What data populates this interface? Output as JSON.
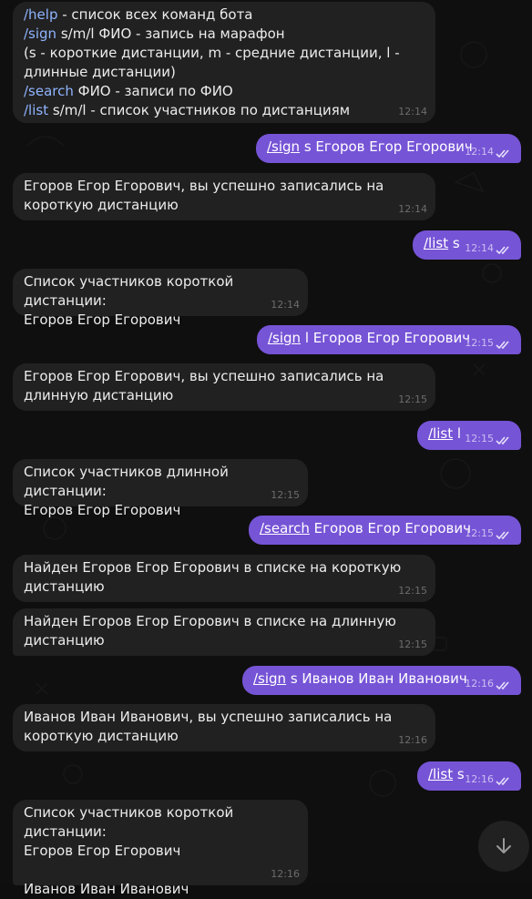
{
  "messages": [
    {
      "id": "m1",
      "side": "in",
      "parts": [
        {
          "cmd": "/help",
          "text": " - список всех команд бота\n"
        },
        {
          "cmd": "/sign",
          "text": " s/m/l ФИО - запись на марафон\n(s - короткие дистанции, m - средние дистанции, l - длинные дистанции)\n"
        },
        {
          "cmd": "/search",
          "text": " ФИО - записи по ФИО\n"
        },
        {
          "cmd": "/list",
          "text": " s/m/l - список участников по дистанциям"
        }
      ],
      "time": "12:14"
    },
    {
      "id": "m2",
      "side": "out",
      "parts": [
        {
          "cmd": "/sign",
          "text": " s Егоров Егор Егорович"
        }
      ],
      "time": "12:14"
    },
    {
      "id": "m3",
      "side": "in",
      "parts": [
        {
          "cmd": "",
          "text": "Егоров Егор Егорович, вы успешно записались на короткую дистанцию"
        }
      ],
      "time": "12:14"
    },
    {
      "id": "m4",
      "side": "out",
      "parts": [
        {
          "cmd": "/list",
          "text": " s"
        }
      ],
      "time": "12:14"
    },
    {
      "id": "m5",
      "side": "in",
      "parts": [
        {
          "cmd": "",
          "text": "Список участников короткой дистанции:\nЕгоров Егор Егорович"
        }
      ],
      "time": "12:14"
    },
    {
      "id": "m6",
      "side": "out",
      "parts": [
        {
          "cmd": "/sign",
          "text": " l Егоров Егор Егорович"
        }
      ],
      "time": "12:15"
    },
    {
      "id": "m7",
      "side": "in",
      "parts": [
        {
          "cmd": "",
          "text": "Егоров Егор Егорович, вы успешно записались на длинную дистанцию"
        }
      ],
      "time": "12:15"
    },
    {
      "id": "m8",
      "side": "out",
      "parts": [
        {
          "cmd": "/list",
          "text": " l"
        }
      ],
      "time": "12:15"
    },
    {
      "id": "m9",
      "side": "in",
      "parts": [
        {
          "cmd": "",
          "text": "Список участников длинной дистанции:\nЕгоров Егор Егорович"
        }
      ],
      "time": "12:15"
    },
    {
      "id": "m10",
      "side": "out",
      "parts": [
        {
          "cmd": "/search",
          "text": " Егоров Егор Егорович"
        }
      ],
      "time": "12:15"
    },
    {
      "id": "m11",
      "side": "in",
      "parts": [
        {
          "cmd": "",
          "text": "Найден Егоров Егор Егорович в списке на короткую дистанцию"
        }
      ],
      "time": "12:15"
    },
    {
      "id": "m12",
      "side": "in",
      "parts": [
        {
          "cmd": "",
          "text": "Найден Егоров Егор Егорович в списке на длинную дистанцию"
        }
      ],
      "time": "12:15"
    },
    {
      "id": "m13",
      "side": "out",
      "parts": [
        {
          "cmd": "/sign",
          "text": " s Иванов Иван Иванович"
        }
      ],
      "time": "12:16"
    },
    {
      "id": "m14",
      "side": "in",
      "parts": [
        {
          "cmd": "",
          "text": "Иванов Иван Иванович, вы успешно записались на короткую дистанцию"
        }
      ],
      "time": "12:16"
    },
    {
      "id": "m15",
      "side": "out",
      "parts": [
        {
          "cmd": "/list",
          "text": " s"
        }
      ],
      "time": "12:16"
    },
    {
      "id": "m16",
      "side": "in",
      "parts": [
        {
          "cmd": "",
          "text": "Список участников короткой дистанции:\nЕгоров Егор Егорович\n\nИванов Иван Иванович"
        }
      ],
      "time": "12:16"
    }
  ],
  "icons": {
    "read_status": "double-check-icon",
    "scroll_down": "arrow-down-icon"
  },
  "colors": {
    "outgoing": "#7654d6",
    "incoming": "#212121",
    "command_link": "#8fb4ff",
    "background": "#0f0f0f"
  }
}
